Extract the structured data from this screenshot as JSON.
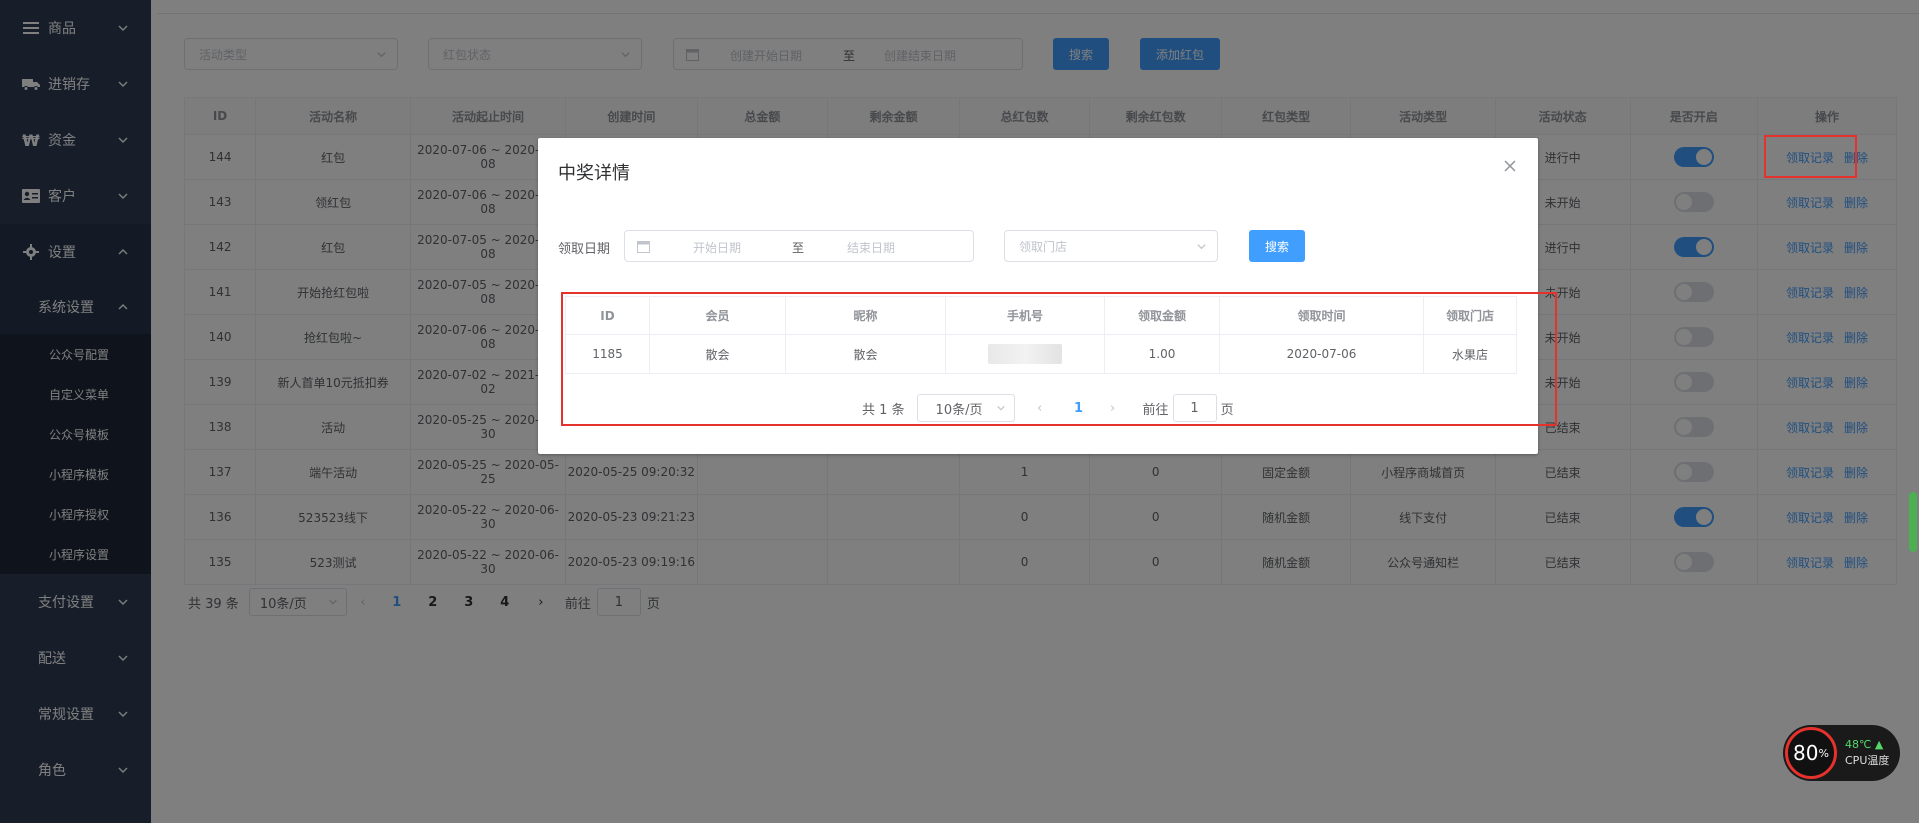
{
  "sidebar": {
    "top_items": [
      {
        "label": "商品",
        "icon": "menu-lines-icon"
      },
      {
        "label": "进销存",
        "icon": "truck-icon"
      },
      {
        "label": "资金",
        "icon": "won-icon"
      },
      {
        "label": "客户",
        "icon": "id-card-icon"
      }
    ],
    "settings": {
      "label": "设置",
      "icon": "gear-icon"
    },
    "system_settings": {
      "label": "系统设置",
      "items": [
        "公众号配置",
        "自定义菜单",
        "公众号模板",
        "小程序模板",
        "小程序授权",
        "小程序设置"
      ]
    },
    "other_items": [
      "支付设置",
      "配送",
      "常规设置",
      "角色"
    ]
  },
  "filters": {
    "activity_type_placeholder": "活动类型",
    "status_placeholder": "红包状态",
    "start_date_placeholder": "创建开始日期",
    "range_sep": "至",
    "end_date_placeholder": "创建结束日期",
    "search_label": "搜索",
    "add_label": "添加红包"
  },
  "table": {
    "headers": [
      "ID",
      "活动名称",
      "活动起止时间",
      "创建时间",
      "总金额",
      "剩余金额",
      "总红包数",
      "剩余红包数",
      "红包类型",
      "活动类型",
      "活动状态",
      "是否开启",
      "操作"
    ],
    "action_records": "领取记录",
    "action_delete": "删除",
    "rows": [
      {
        "id": "144",
        "name": "红包",
        "period": "2020-07-06 ~ 2020-07-08",
        "created": "",
        "total": "",
        "remain": "",
        "count": "",
        "remain_count": "",
        "type": "",
        "act_type": "",
        "status": "进行中",
        "on": true
      },
      {
        "id": "143",
        "name": "领红包",
        "period": "2020-07-06 ~ 2020-07-08",
        "created": "",
        "total": "",
        "remain": "",
        "count": "",
        "remain_count": "",
        "type": "",
        "act_type": "",
        "status": "未开始",
        "on": false
      },
      {
        "id": "142",
        "name": "红包",
        "period": "2020-07-05 ~ 2020-07-08",
        "created": "",
        "total": "",
        "remain": "",
        "count": "",
        "remain_count": "",
        "type": "",
        "act_type": "",
        "status": "进行中",
        "on": true
      },
      {
        "id": "141",
        "name": "开始抢红包啦",
        "period": "2020-07-05 ~ 2020-07-08",
        "created": "",
        "total": "",
        "remain": "",
        "count": "",
        "remain_count": "",
        "type": "",
        "act_type": "",
        "status": "未开始",
        "on": false
      },
      {
        "id": "140",
        "name": "抢红包啦~",
        "period": "2020-07-06 ~ 2020-07-08",
        "created": "",
        "total": "",
        "remain": "",
        "count": "",
        "remain_count": "",
        "type": "",
        "act_type": "",
        "status": "未开始",
        "on": false
      },
      {
        "id": "139",
        "name": "新人首单10元抵扣券",
        "period": "2020-07-02 ~ 2021-07-02",
        "created": "",
        "total": "",
        "remain": "",
        "count": "",
        "remain_count": "",
        "type": "",
        "act_type": "",
        "status": "未开始",
        "on": false
      },
      {
        "id": "138",
        "name": "活动",
        "period": "2020-05-25 ~ 2020-05-30",
        "created": "",
        "total": "",
        "remain": "",
        "count": "",
        "remain_count": "",
        "type": "",
        "act_type": "",
        "status": "已结束",
        "on": false
      },
      {
        "id": "137",
        "name": "端午活动",
        "period": "2020-05-25 ~ 2020-05-25",
        "created": "2020-05-25 09:20:32",
        "total": "",
        "remain": "",
        "count": "1",
        "remain_count": "0",
        "type": "固定金额",
        "act_type": "小程序商城首页",
        "status": "已结束",
        "on": false
      },
      {
        "id": "136",
        "name": "523523线下",
        "period": "2020-05-22 ~ 2020-06-30",
        "created": "2020-05-23 09:21:23",
        "total": "",
        "remain": "",
        "count": "0",
        "remain_count": "0",
        "type": "随机金额",
        "act_type": "线下支付",
        "status": "已结束",
        "on": true
      },
      {
        "id": "135",
        "name": "523测试",
        "period": "2020-05-22 ~ 2020-06-30",
        "created": "2020-05-23 09:19:16",
        "total": "",
        "remain": "",
        "count": "0",
        "remain_count": "0",
        "type": "随机金额",
        "act_type": "公众号通知栏",
        "status": "已结束",
        "on": false
      }
    ]
  },
  "pager": {
    "total": "共 39 条",
    "page_size": "10条/页",
    "pages": [
      "1",
      "2",
      "3",
      "4"
    ],
    "current": "1",
    "goto_prefix": "前往",
    "goto_value": "1",
    "goto_suffix": "页"
  },
  "dialog": {
    "title": "中奖详情",
    "date_label": "领取日期",
    "start_placeholder": "开始日期",
    "range_sep": "至",
    "end_placeholder": "结束日期",
    "store_placeholder": "领取门店",
    "search_label": "搜索",
    "headers": [
      "ID",
      "会员",
      "昵称",
      "手机号",
      "领取金额",
      "领取时间",
      "领取门店"
    ],
    "rows": [
      {
        "id": "1185",
        "member": "散会",
        "nickname": "散会",
        "phone": "",
        "amount": "1.00",
        "time": "2020-07-06",
        "store": "水果店"
      }
    ],
    "pager": {
      "total": "共 1 条",
      "page_size": "10条/页",
      "current": "1",
      "goto_prefix": "前往",
      "goto_value": "1",
      "goto_suffix": "页"
    }
  },
  "cpu": {
    "value": "80",
    "unit": "%",
    "temp": "48℃",
    "label": "CPU温度"
  },
  "colors": {
    "sidebar_bg": "#2e3d55",
    "primary": "#409eff",
    "highlight": "#e5322d"
  }
}
